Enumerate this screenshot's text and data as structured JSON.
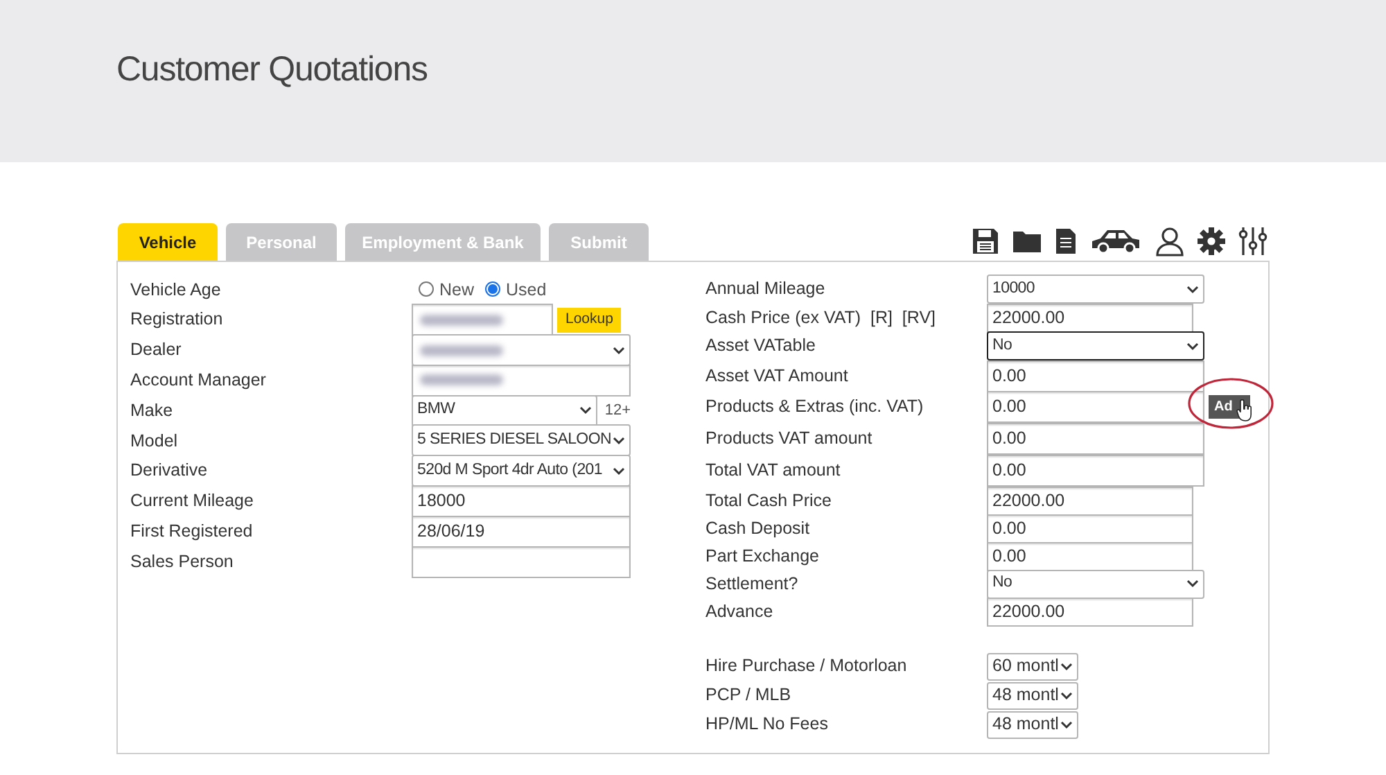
{
  "page_title": "Customer Quotations",
  "tabs": [
    {
      "label": "Vehicle",
      "selected": true
    },
    {
      "label": "Personal",
      "selected": false
    },
    {
      "label": "Employment & Bank",
      "selected": false
    },
    {
      "label": "Submit",
      "selected": false
    }
  ],
  "left_fields": [
    {
      "label": "Vehicle Age",
      "kind": "radio",
      "options": [
        {
          "label": "New",
          "selected": false
        },
        {
          "label": "Used",
          "selected": true
        }
      ]
    },
    {
      "label": "Registration",
      "kind": "lookup",
      "blurred": true,
      "button": "Lookup"
    },
    {
      "label": "Dealer",
      "kind": "select",
      "blurred": true
    },
    {
      "label": "Account Manager",
      "kind": "input",
      "blurred": true
    },
    {
      "label": "Make",
      "kind": "select",
      "value": "BMW",
      "note": "12+"
    },
    {
      "label": "Model",
      "kind": "select",
      "value": "5 SERIES DIESEL SALOON"
    },
    {
      "label": "Derivative",
      "kind": "select",
      "value": "520d M Sport 4dr Auto (201"
    },
    {
      "label": "Current Mileage",
      "kind": "input",
      "value": "18000"
    },
    {
      "label": "First Registered",
      "kind": "input",
      "value": "28/06/19"
    },
    {
      "label": "Sales Person",
      "kind": "input"
    }
  ],
  "right_fields": [
    {
      "label": "Annual Mileage",
      "kind": "select",
      "value": "10000"
    },
    {
      "label": "Cash Price (ex VAT)  [R]  [RV]",
      "kind": "input",
      "value": "22000.00"
    },
    {
      "label": "Asset VATable",
      "kind": "select",
      "value": "No",
      "focused": true
    },
    {
      "label": "Asset VAT Amount",
      "kind": "input",
      "value": "0.00"
    },
    {
      "label": "Products & Extras (inc. VAT)",
      "kind": "input",
      "value": "0.00",
      "button": "Ad"
    },
    {
      "label": "Products VAT amount",
      "kind": "input",
      "value": "0.00"
    },
    {
      "label": "Total VAT amount",
      "kind": "input",
      "value": "0.00"
    },
    {
      "label": "Total Cash Price",
      "kind": "input",
      "value": "22000.00"
    },
    {
      "label": "Cash Deposit",
      "kind": "input",
      "value": "0.00"
    },
    {
      "label": "Part Exchange",
      "kind": "input",
      "value": "0.00"
    },
    {
      "label": "Settlement?",
      "kind": "select",
      "value": "No"
    },
    {
      "label": "Advance",
      "kind": "input",
      "value": "22000.00"
    }
  ],
  "term_fields": [
    {
      "label": "Hire Purchase / Motorloan",
      "value": "60 montl"
    },
    {
      "label": "PCP / MLB",
      "value": "48 montl"
    },
    {
      "label": "HP/ML No Fees",
      "value": "48 montl"
    }
  ]
}
